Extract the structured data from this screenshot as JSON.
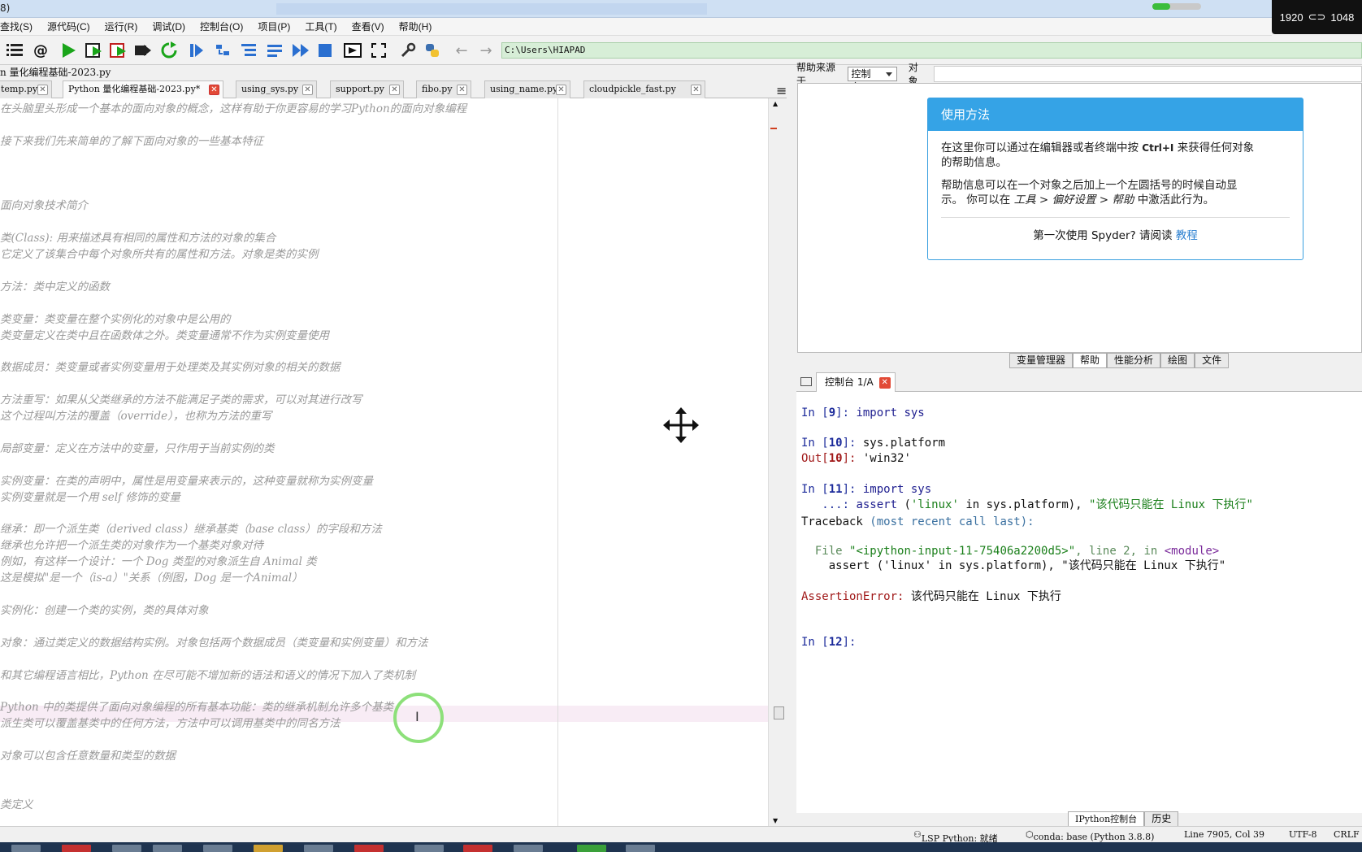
{
  "window": {
    "title_fragment": "8)",
    "resolution": [
      "1920",
      "1048"
    ]
  },
  "menu": [
    "查找(S)",
    "源代码(C)",
    "运行(R)",
    "调试(D)",
    "控制台(O)",
    "项目(P)",
    "工具(T)",
    "查看(V)",
    "帮助(H)"
  ],
  "toolbar": {
    "icons": [
      "list-icon",
      "at-icon",
      "run-icon",
      "run-cell-icon",
      "run-cell-advance-icon",
      "run-selection-icon",
      "rerun-icon",
      "debug-icon",
      "step-icon",
      "step-into-icon",
      "step-return-icon",
      "continue-icon",
      "stop-icon",
      "maximize-pane-icon",
      "fullscreen-icon",
      "wrench-icon",
      "python-icon",
      "back-arrow-icon",
      "forward-arrow-icon"
    ],
    "path": "C:\\Users\\HIAPAD"
  },
  "editor": {
    "file_label": "n 量化编程基础-2023.py",
    "tabs": [
      {
        "label": "temp.py"
      },
      {
        "label": "Python 量化编程基础-2023.py*",
        "active": true
      },
      {
        "label": "using_sys.py"
      },
      {
        "label": "support.py"
      },
      {
        "label": "fibo.py"
      },
      {
        "label": "using_name.py"
      },
      {
        "label": "cloudpickle_fast.py"
      }
    ],
    "lines": [
      {
        "row": 0,
        "text": "在头脑里头形成一个基本的面向对象的概念，这样有助于你更容易的学习Python的面向对象编程"
      },
      {
        "row": 2,
        "text": "接下来我们先来简单的了解下面向对象的一些基本特征"
      },
      {
        "row": 6,
        "text": "面向对象技术简介"
      },
      {
        "row": 8,
        "text": "类(Class): 用来描述具有相同的属性和方法的对象的集合"
      },
      {
        "row": 9,
        "text": "它定义了该集合中每个对象所共有的属性和方法。对象是类的实例"
      },
      {
        "row": 11,
        "text": "方法：类中定义的函数"
      },
      {
        "row": 13,
        "text": "类变量：类变量在整个实例化的对象中是公用的"
      },
      {
        "row": 14,
        "text": "类变量定义在类中且在函数体之外。类变量通常不作为实例变量使用"
      },
      {
        "row": 16,
        "text": "数据成员：类变量或者实例变量用于处理类及其实例对象的相关的数据"
      },
      {
        "row": 18,
        "text": "方法重写：如果从父类继承的方法不能满足子类的需求，可以对其进行改写"
      },
      {
        "row": 19,
        "text": "这个过程叫方法的覆盖（override），也称为方法的重写"
      },
      {
        "row": 21,
        "text": "局部变量：定义在方法中的变量，只作用于当前实例的类"
      },
      {
        "row": 23,
        "text": "实例变量：在类的声明中，属性是用变量来表示的，这种变量就称为实例变量"
      },
      {
        "row": 24,
        "text": "实例变量就是一个用 self 修饰的变量"
      },
      {
        "row": 26,
        "text": "继承：即一个派生类（derived class）继承基类（base class）的字段和方法"
      },
      {
        "row": 27,
        "text": "继承也允许把一个派生类的对象作为一个基类对象对待"
      },
      {
        "row": 28,
        "text": "例如，有这样一个设计：一个 Dog 类型的对象派生自 Animal 类"
      },
      {
        "row": 29,
        "text": "这是模拟\"是一个（is-a）\"关系（例图，Dog 是一个Animal）"
      },
      {
        "row": 31,
        "text": "实例化：创建一个类的实例，类的具体对象"
      },
      {
        "row": 33,
        "text": "对象：通过类定义的数据结构实例。对象包括两个数据成员（类变量和实例变量）和方法"
      },
      {
        "row": 35,
        "text": "和其它编程语言相比，Python 在尽可能不增加新的语法和语义的情况下加入了类机制"
      },
      {
        "row": 37,
        "text": "Python 中的类提供了面向对象编程的所有基本功能：类的继承机制允许多个基类"
      },
      {
        "row": 38,
        "text": "派生类可以覆盖基类中的任何方法，方法中可以调用基类中的同名方法"
      },
      {
        "row": 40,
        "text": "对象可以包含任意数量和类型的数据"
      },
      {
        "row": 43,
        "text": "类定义"
      }
    ]
  },
  "help": {
    "source_label": "帮助来源于",
    "source_value": "控制台",
    "object_label": "对象",
    "card_title": "使用方法",
    "para1_a": "在这里你可以通过在编辑器或者终端中按",
    "para1_key": "Ctrl+I",
    "para1_b": "来获得任何对象",
    "para1_c": "的帮助信息。",
    "para2_a": "帮助信息可以在一个对象之后加上一个左圆括号的时候自动显",
    "para2_b": "示。 你可以在",
    "para2_path": "工具 > 偏好设置 > 帮助",
    "para2_c": "中激活此行为。",
    "footer_text": "第一次使用 Spyder? 请阅读",
    "footer_link": "教程"
  },
  "pane_tabs": [
    "变量管理器",
    "帮助",
    "性能分析",
    "绘图",
    "文件"
  ],
  "console": {
    "tab_label": "控制台 1/A",
    "in9": "import sys",
    "in10": "sys.platform",
    "out10": "'win32'",
    "in11": "import sys",
    "cont": "   ...: ",
    "assert_kw": "assert",
    "assert_lit": "'linux'",
    "assert_in": " in sys.platform), ",
    "assert_msg": "\"该代码只能在 Linux 下执行\"",
    "traceback": "Traceback",
    "traceback_note": "(most recent call last):",
    "file_line_a": "  File ",
    "file_str": "\"<ipython-input-11-75406a2200d5>\"",
    "file_line_b": ", line 2, in ",
    "module": "<module>",
    "assert_repeat": "    assert ('linux' in sys.platform), \"该代码只能在 Linux 下执行\"",
    "error_name": "AssertionError:",
    "error_msg": " 该代码只能在 Linux 下执行",
    "prompt12": "In [12]: ",
    "n9": "9",
    "n10": "10",
    "n11": "11",
    "n12": "12"
  },
  "bottom_tabs": [
    "IPython控制台",
    "历史"
  ],
  "status": {
    "lsp": "LSP Python: 就绪",
    "conda": "conda: base (Python 3.8.8)",
    "position": "Line 7905, Col 39",
    "encoding": "UTF-8",
    "eol": "CRLF"
  },
  "colors": {
    "accent": "#35a3e6",
    "close_red": "#e24a36",
    "path_green": "#d7eed7"
  }
}
